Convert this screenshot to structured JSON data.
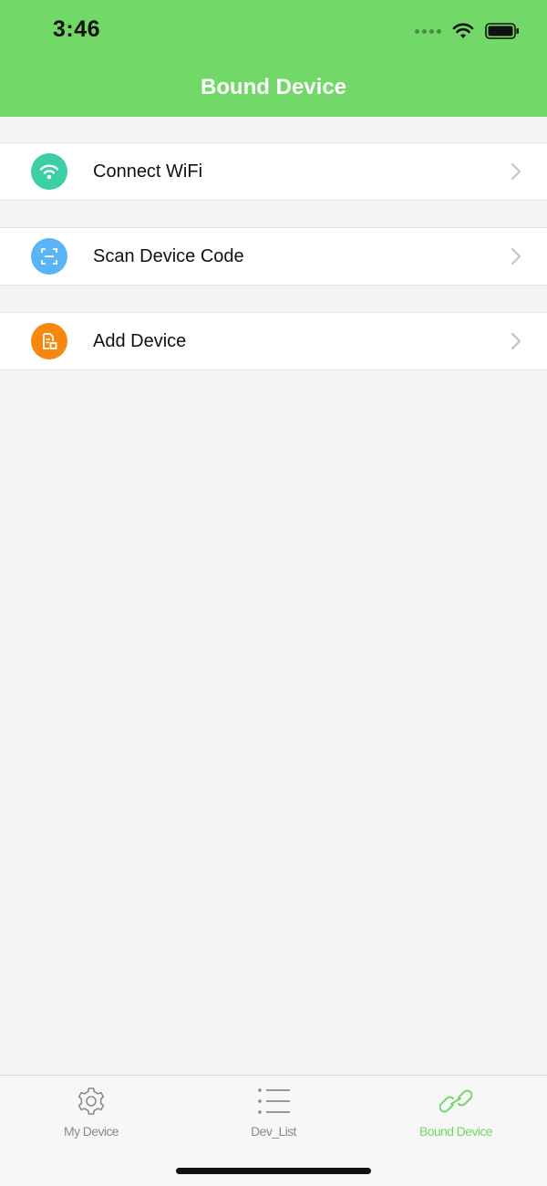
{
  "status_bar": {
    "time": "3:46"
  },
  "nav": {
    "title": "Bound Device"
  },
  "menu": {
    "items": [
      {
        "label": "Connect WiFi",
        "icon": "wifi-icon",
        "color": "#3ccfa6"
      },
      {
        "label": "Scan Device Code",
        "icon": "scan-icon",
        "color": "#5bb4f5"
      },
      {
        "label": "Add Device",
        "icon": "add-device-icon",
        "color": "#f6870f"
      }
    ]
  },
  "tabbar": {
    "tabs": [
      {
        "label": "My Device",
        "icon": "gear-icon",
        "active": false
      },
      {
        "label": "Dev_List",
        "icon": "list-icon",
        "active": false
      },
      {
        "label": "Bound Device",
        "icon": "link-icon",
        "active": true
      }
    ]
  },
  "colors": {
    "accent": "#72d867",
    "background": "#f4f4f4",
    "inactive_tab": "#8a8a8a"
  }
}
